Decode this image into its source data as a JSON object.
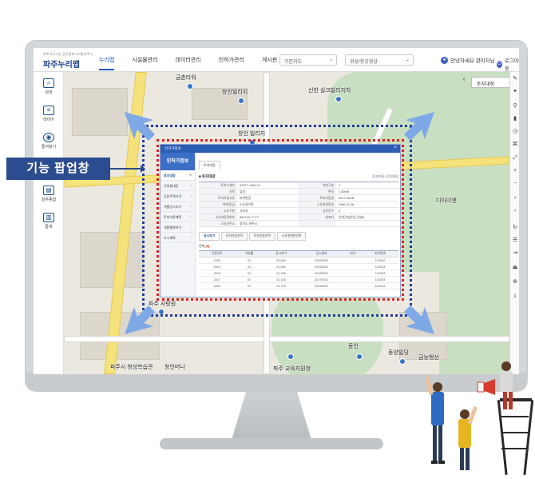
{
  "callout_label": "기능 팝업창",
  "header": {
    "logo_sub": "파주기 도시는 공간정보시스템 파주시",
    "logo": "파주누리맵",
    "nav": [
      "누리맵",
      "시설물관리",
      "데이터관리",
      "인허가관리",
      "게시판"
    ],
    "select_base": "기본지도",
    "select_sat": "위성/항공영상",
    "user_greeting": "안녕하세요 관리자님",
    "logout": "로그아웃"
  },
  "sidebar": {
    "items": [
      {
        "label": "검색"
      },
      {
        "label": "레이어"
      },
      {
        "label": "즐겨찾기"
      },
      {
        "label": "실무종합"
      },
      {
        "label": "통계"
      }
    ]
  },
  "map": {
    "map_select": "토지대장",
    "labels": [
      "금촌타워",
      "창인빌리지",
      "신한 실크빌리지차",
      "창인 빌리지",
      "창인",
      "파주 사랑원",
      "동인",
      "동양빌딩",
      "금능행선",
      "파주시 청성학습관",
      "창인머나",
      "파주 교육지원청",
      "디아이엔"
    ]
  },
  "popup": {
    "title": "인허가정보",
    "left_header": "인허가정보",
    "left_items": [
      "토지대장",
      "건축물대장",
      "공동주택가격",
      "개별공시지가",
      "토지이용계획",
      "개발행위허가",
      "도시계획"
    ],
    "top_tab": "토지대장",
    "section_title": "■ 토지대장",
    "section_right": "토지이동 | 토지대장",
    "kv": [
      [
        "토지소재지",
        "57027-1403-10",
        "지번구분",
        "1"
      ],
      [
        "지목",
        "임야",
        "면적",
        "1,306㎡"
      ],
      [
        "토지이동사유",
        "지목변경",
        "토지이동일",
        "2017-08-08"
      ],
      [
        "축척/등급",
        "소유권이전",
        "소유권변동일",
        "1990-11-08"
      ],
      [
        "소유구분",
        "국유지",
        "공유인수",
        "0"
      ],
      [
        "소유자등록번호",
        "890123-*******",
        "대표자",
        "인천건설산업 건설부"
      ],
      [
        "소유자주소",
        "경기도 파주시",
        "",
        ""
      ]
    ],
    "tabs2": [
      "공시지가",
      "토지이동연혁",
      "토지이동연혁",
      "소유권변동연혁"
    ],
    "count_prefix": "전체",
    "count_value": "[5]",
    "grid_headers": [
      "기준년도",
      "기본월",
      "공시지가",
      "공시일자",
      "비고",
      "지가번호"
    ],
    "grid_rows": [
      [
        "2020",
        "01",
        "23,800",
        "20200529",
        "",
        "101002"
      ],
      [
        "2019",
        "01",
        "22,800",
        "20190531",
        "",
        "101003"
      ],
      [
        "2018",
        "01",
        "21,900",
        "20180531",
        "",
        "101003"
      ],
      [
        "2017",
        "01",
        "21,100",
        "20170531",
        "",
        "101003"
      ],
      [
        "2016",
        "01",
        "20,700",
        "20160531",
        "",
        "101003"
      ]
    ]
  },
  "colors": {
    "brand_blue": "#1a57c9",
    "frame_blue": "#1f3f9c",
    "frame_red": "#e0201c",
    "callout_bg": "#2b4c8f"
  }
}
